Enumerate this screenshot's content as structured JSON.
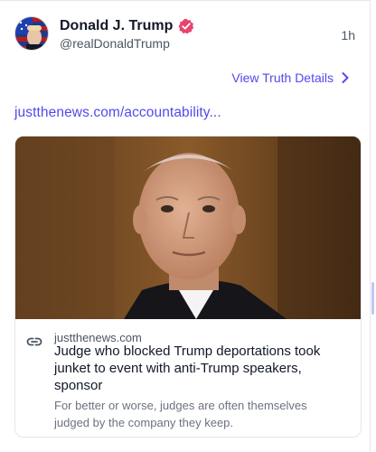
{
  "post": {
    "author": {
      "display_name": "Donald J. Trump",
      "handle": "@realDonaldTrump",
      "verified_icon": "verified-badge-icon",
      "badge_color": "#e8436f"
    },
    "timestamp": "1h",
    "view_details_label": "View Truth Details",
    "link_text": "justthenews.com/accountability...",
    "accent_color": "#5448ee"
  },
  "card": {
    "image_icon": "article-photo",
    "domain": "justthenews.com",
    "title": "Judge who blocked Trump deportations took junket to event with anti-Trump speakers, sponsor",
    "description": "For better or worse, judges are often themselves judged by the company they keep."
  }
}
